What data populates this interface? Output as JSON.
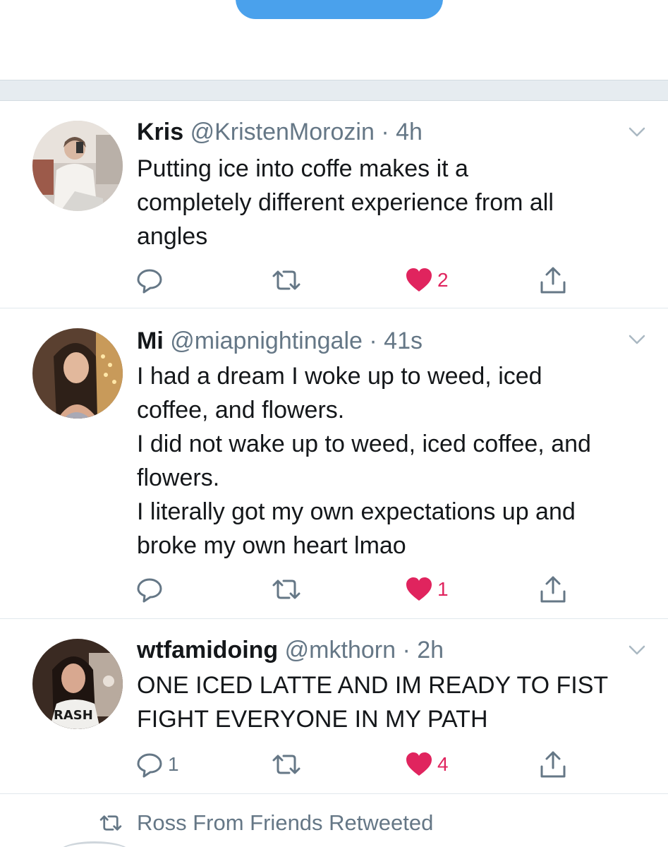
{
  "colors": {
    "accent": "#4aa1ec",
    "like": "#e0245e",
    "secondary_text": "#657786",
    "primary_text": "#14171a",
    "divider": "#e1e8ed",
    "band": "#e6ecf0"
  },
  "tweets": [
    {
      "name": "Kris",
      "handle": "@KristenMorozin",
      "separator": "·",
      "time": "4h",
      "lines": [
        "Putting ice into coffe makes it a",
        "completely different experience from all",
        "angles"
      ],
      "reply_count": "",
      "like_count": "2",
      "liked": true
    },
    {
      "name": "Mi",
      "handle": "@miapnightingale",
      "separator": "·",
      "time": "41s",
      "lines": [
        "I had a dream I woke up to weed, iced",
        "coffee, and flowers.",
        "I did not wake up to weed, iced coffee, and",
        "flowers.",
        "I literally got my own expectations up and",
        "broke my own heart lmao"
      ],
      "reply_count": "",
      "like_count": "1",
      "liked": true
    },
    {
      "name": "wtfamidoing",
      "handle": "@mkthorn",
      "separator": "·",
      "time": "2h",
      "lines": [
        "ONE ICED LATTE AND IM READY TO FIST",
        "FIGHT EVERYONE IN MY PATH"
      ],
      "reply_count": "1",
      "like_count": "4",
      "liked": true
    }
  ],
  "retweet_context": "Ross From Friends Retweeted",
  "icons": {
    "reply": "reply-icon",
    "retweet": "retweet-icon",
    "like": "heart-icon",
    "share": "share-icon",
    "caret": "chevron-down-icon"
  }
}
